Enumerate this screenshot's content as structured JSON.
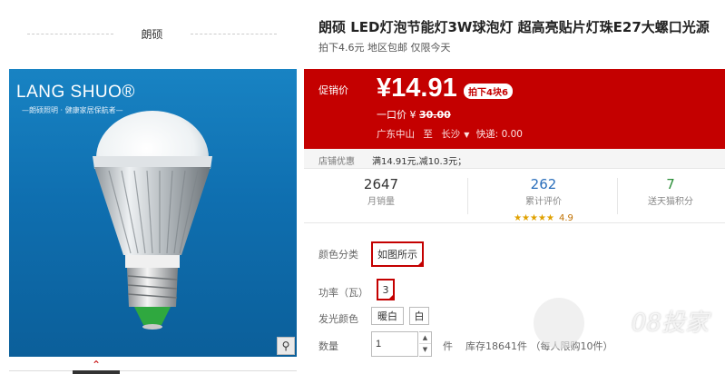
{
  "store": {
    "name": "朗硕"
  },
  "product_image": {
    "brand_logo": "LANG SHUO®",
    "brand_slogan": "—朗硕照明 · 健康家居保航者—"
  },
  "thumbnail_nav": {
    "arrow": "⌃"
  },
  "product": {
    "title": "朗硕 LED灯泡节能灯3W球泡灯 超高亮贴片灯珠E27大螺口光源",
    "subtitle": "拍下4.6元 地区包邮 仅限今天"
  },
  "promo": {
    "label": "促销价",
    "price": "¥14.91",
    "tag": "拍下4块6",
    "original_label": "一口价 ¥",
    "original_price": "30.00",
    "ship_from": "广东中山",
    "ship_to_label": "至",
    "ship_to": "长沙",
    "express": "快递: 0.00"
  },
  "coupon": {
    "label": "店铺优惠",
    "value": "满14.91元,减10.3元；"
  },
  "stats": {
    "monthly_sales": {
      "value": "2647",
      "label": "月销量"
    },
    "reviews": {
      "value": "262",
      "label": "累计评价",
      "stars": "★★★★★",
      "rating": "4.9"
    },
    "points": {
      "value": "7",
      "label": "送天猫积分"
    }
  },
  "options": {
    "color": {
      "label": "颜色分类",
      "selected": "如图所示"
    },
    "power": {
      "label": "功率（瓦）",
      "selected": "3"
    },
    "light": {
      "label": "发光颜色",
      "choices": [
        "暖白",
        "白"
      ]
    }
  },
  "quantity": {
    "label": "数量",
    "value": "1",
    "unit": "件",
    "stock": "库存18641件 （每人限购10件）"
  },
  "watermark": "08投家",
  "colors": {
    "accent": "#c40000",
    "image_bg": "#1883c3",
    "link": "#2a6ebb",
    "green": "#2d8f3a"
  }
}
